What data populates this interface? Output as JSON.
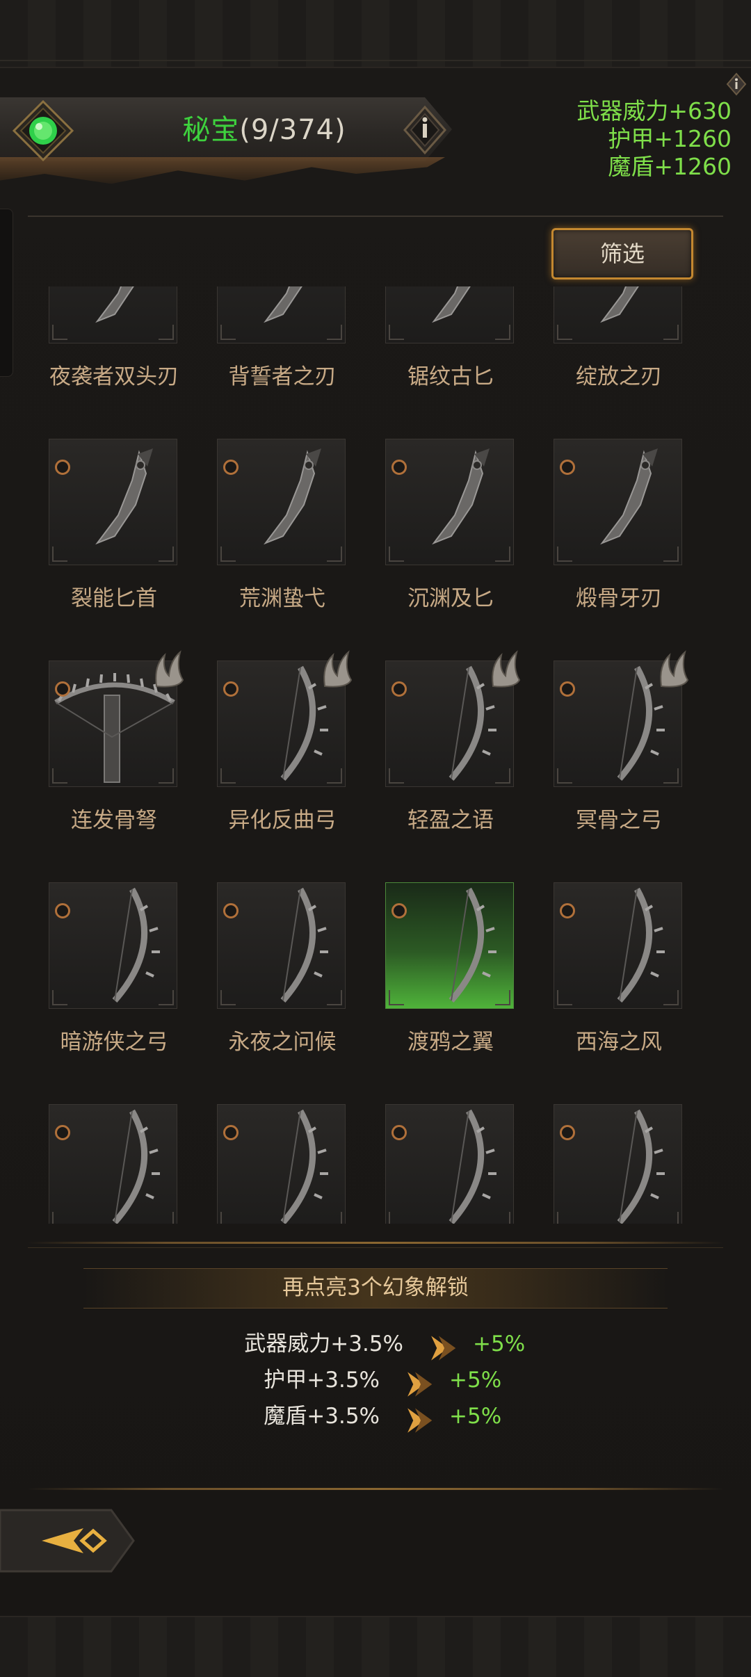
{
  "header": {
    "title_name": "秘宝",
    "title_count": "(9/374)"
  },
  "bonuses": [
    "武器威力+630",
    "护甲+1260",
    "魔盾+1260"
  ],
  "filter_label": "筛选",
  "items": [
    {
      "name": "夜袭者双头刃",
      "type": "dagger",
      "badge": false,
      "rare": false
    },
    {
      "name": "背誓者之刃",
      "type": "dagger",
      "badge": false,
      "rare": false
    },
    {
      "name": "锯纹古匕",
      "type": "dagger",
      "badge": false,
      "rare": false
    },
    {
      "name": "绽放之刃",
      "type": "dagger",
      "badge": false,
      "rare": false
    },
    {
      "name": "裂能匕首",
      "type": "dagger",
      "badge": false,
      "rare": false
    },
    {
      "name": "荒渊蛰弋",
      "type": "dagger",
      "badge": false,
      "rare": false
    },
    {
      "name": "沉渊及匕",
      "type": "dagger",
      "badge": false,
      "rare": false
    },
    {
      "name": "煅骨牙刃",
      "type": "dagger",
      "badge": false,
      "rare": false
    },
    {
      "name": "连发骨弩",
      "type": "crossbow",
      "badge": true,
      "rare": false
    },
    {
      "name": "异化反曲弓",
      "type": "bow",
      "badge": true,
      "rare": false
    },
    {
      "name": "轻盈之语",
      "type": "bow",
      "badge": true,
      "rare": false
    },
    {
      "name": "冥骨之弓",
      "type": "bow",
      "badge": true,
      "rare": false
    },
    {
      "name": "暗游侠之弓",
      "type": "bow",
      "badge": false,
      "rare": false
    },
    {
      "name": "永夜之问候",
      "type": "bow",
      "badge": false,
      "rare": false
    },
    {
      "name": "渡鸦之翼",
      "type": "bow",
      "badge": false,
      "rare": true
    },
    {
      "name": "西海之风",
      "type": "bow",
      "badge": false,
      "rare": false
    },
    {
      "name": "",
      "type": "bow",
      "badge": false,
      "rare": false
    },
    {
      "name": "",
      "type": "bow",
      "badge": false,
      "rare": false
    },
    {
      "name": "",
      "type": "bow",
      "badge": false,
      "rare": false
    },
    {
      "name": "",
      "type": "bow",
      "badge": false,
      "rare": false
    }
  ],
  "unlock": {
    "title": "再点亮3个幻象解锁",
    "rows": [
      {
        "current": "武器威力+3.5%",
        "next": "+5%"
      },
      {
        "current": "护甲+3.5%",
        "next": "+5%"
      },
      {
        "current": "魔盾+3.5%",
        "next": "+5%"
      }
    ]
  },
  "colors": {
    "accent_green": "#3ed23e",
    "bonus_green": "#7fdf4a",
    "gold": "#c48830",
    "item_name": "#c8aa86"
  }
}
